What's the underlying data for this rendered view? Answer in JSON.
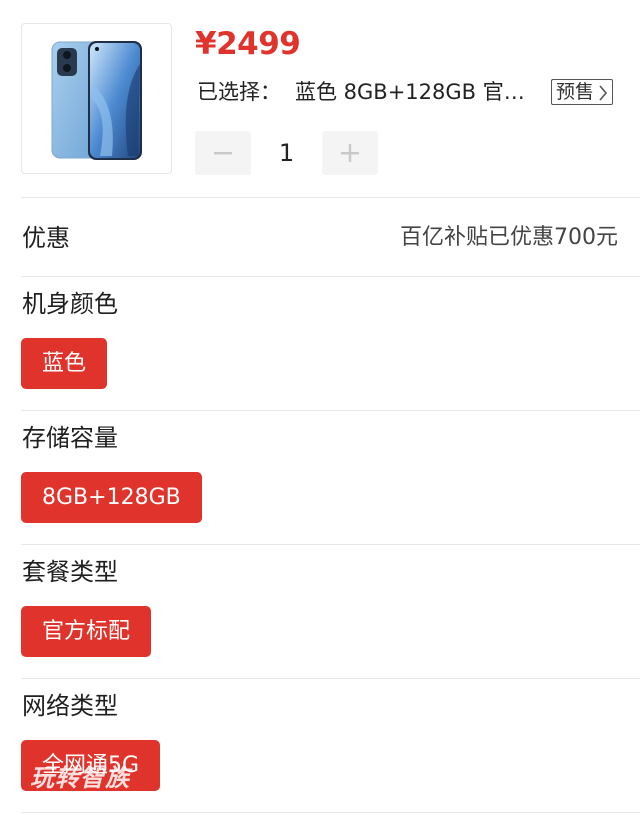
{
  "product": {
    "image_alt": "phone-image",
    "price": "¥2499",
    "selected_label": "已选择：",
    "selected_value": "蓝色 8GB+128GB 官方…",
    "presale_badge": "预售",
    "quantity": "1"
  },
  "discount": {
    "label": "优惠",
    "value": "百亿补贴已优惠700元"
  },
  "groups": [
    {
      "title": "机身颜色",
      "selected_option": "蓝色"
    },
    {
      "title": "存储容量",
      "selected_option": "8GB+128GB"
    },
    {
      "title": "套餐类型",
      "selected_option": "官方标配"
    },
    {
      "title": "网络类型",
      "selected_option": "全网通5G"
    }
  ],
  "watermark": "玩转智族",
  "colors": {
    "accent": "#e0332b",
    "stepper_bg": "#f4f4f4",
    "divider": "#e8e8e8"
  },
  "icons": {
    "minus": "minus-icon",
    "plus": "plus-icon",
    "chevron": "chevron-right-icon"
  }
}
